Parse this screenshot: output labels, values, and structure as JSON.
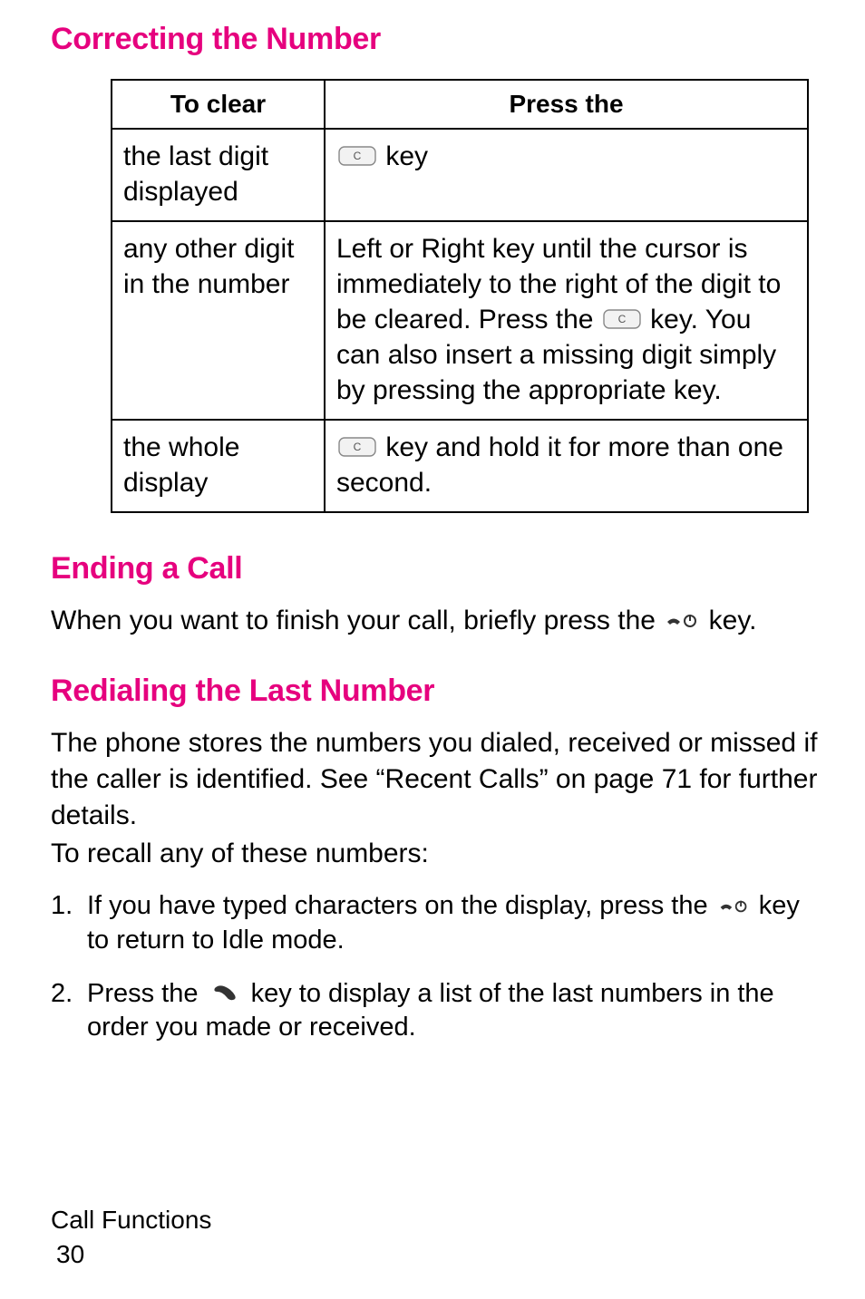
{
  "headings": {
    "correcting": "Correcting the Number",
    "ending": "Ending a Call",
    "redial": "Redialing the Last Number"
  },
  "table": {
    "header_left": "To clear",
    "header_right": "Press the",
    "rows": [
      {
        "left": "the last digit displayed",
        "right_suffix": " key"
      },
      {
        "left": "any other digit in the number",
        "right_prefix": "Left or Right key until the cursor is immediately to the right of the digit to be cleared. Press the ",
        "right_suffix": " key. You can also insert a missing digit simply by pressing the appropriate key."
      },
      {
        "left": "the whole display",
        "right_suffix": " key and hold it for more than one second."
      }
    ]
  },
  "ending_text_prefix": "When you want to finish your call, briefly press the ",
  "ending_text_suffix": " key.",
  "redial_para": "The phone stores the numbers you dialed, received or missed if the caller is identified. See “Recent Calls” on page 71 for further details.",
  "redial_intro": "To recall any of these numbers:",
  "steps": [
    {
      "num": "1.",
      "prefix": "If you have typed characters on the display, press the ",
      "suffix": " key to return to Idle mode."
    },
    {
      "num": "2.",
      "prefix": "Press the ",
      "suffix": " key to display a list of the last numbers in the order you made or received."
    }
  ],
  "footer_section": "Call Functions",
  "footer_page": "30"
}
